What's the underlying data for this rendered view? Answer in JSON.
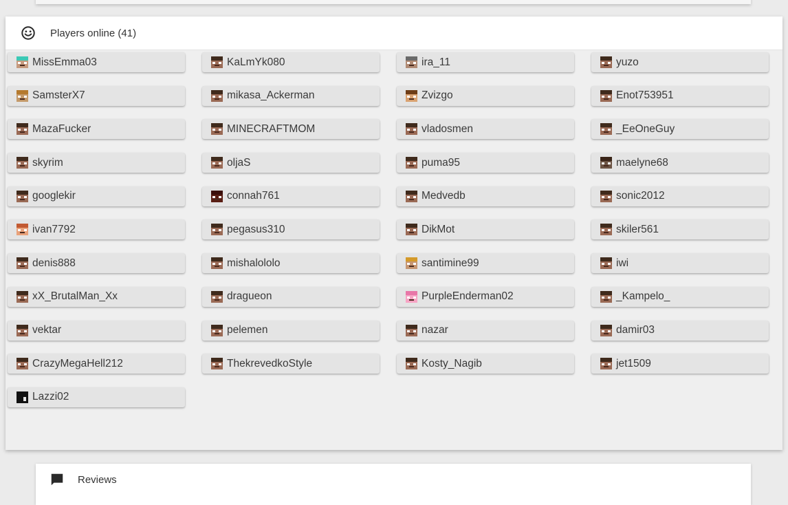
{
  "players_section": {
    "title": "Players online (41)",
    "icon": "smile-icon",
    "players": [
      {
        "name": "MissEmma03",
        "skin": "teal"
      },
      {
        "name": "KaLmYk080",
        "skin": "steve"
      },
      {
        "name": "ira_11",
        "skin": "gray"
      },
      {
        "name": "yuzo",
        "skin": "steve"
      },
      {
        "name": "SamsterX7",
        "skin": "tan"
      },
      {
        "name": "mikasa_Ackerman",
        "skin": "steve"
      },
      {
        "name": "Zvizgo",
        "skin": "face"
      },
      {
        "name": "Enot753951",
        "skin": "steve"
      },
      {
        "name": "MazaFucker",
        "skin": "steve"
      },
      {
        "name": "MINECRAFTMOM",
        "skin": "steve"
      },
      {
        "name": "vladosmen",
        "skin": "steve"
      },
      {
        "name": "_EeOneGuy",
        "skin": "steve"
      },
      {
        "name": "skyrim",
        "skin": "steve"
      },
      {
        "name": "oljaS",
        "skin": "steve"
      },
      {
        "name": "puma95",
        "skin": "steve"
      },
      {
        "name": "maelyne68",
        "skin": "dark"
      },
      {
        "name": "googlekir",
        "skin": "steve"
      },
      {
        "name": "connah761",
        "skin": "red"
      },
      {
        "name": "Medvedb",
        "skin": "steve"
      },
      {
        "name": "sonic2012",
        "skin": "steve"
      },
      {
        "name": "ivan7792",
        "skin": "orange"
      },
      {
        "name": "pegasus310",
        "skin": "steve"
      },
      {
        "name": "DikMot",
        "skin": "steve"
      },
      {
        "name": "skiler561",
        "skin": "steve"
      },
      {
        "name": "denis888",
        "skin": "steve"
      },
      {
        "name": "mishalololo",
        "skin": "steve"
      },
      {
        "name": "santimine99",
        "skin": "blond"
      },
      {
        "name": "iwi",
        "skin": "steve"
      },
      {
        "name": "xX_BrutalMan_Xx",
        "skin": "steve"
      },
      {
        "name": "dragueon",
        "skin": "steve"
      },
      {
        "name": "PurpleEnderman02",
        "skin": "pink"
      },
      {
        "name": "_Kampelo_",
        "skin": "steve"
      },
      {
        "name": "vektar",
        "skin": "steve"
      },
      {
        "name": "pelemen",
        "skin": "steve"
      },
      {
        "name": "nazar",
        "skin": "steve"
      },
      {
        "name": "damir03",
        "skin": "steve"
      },
      {
        "name": "CrazyMegaHell212",
        "skin": "steve"
      },
      {
        "name": "ThekrevedkoStyle",
        "skin": "steve"
      },
      {
        "name": "Kosty_Nagib",
        "skin": "steve"
      },
      {
        "name": "jet1509",
        "skin": "steve"
      },
      {
        "name": "Lazzi02",
        "skin": "black"
      }
    ]
  },
  "reviews_section": {
    "title": "Reviews",
    "icon": "comment-icon"
  },
  "colors": {
    "steve_skin": "#9a6a55",
    "steve_hair": "#3f2a1c",
    "card_bg": "#efefef",
    "chip_bg": "#e4e4e4"
  }
}
